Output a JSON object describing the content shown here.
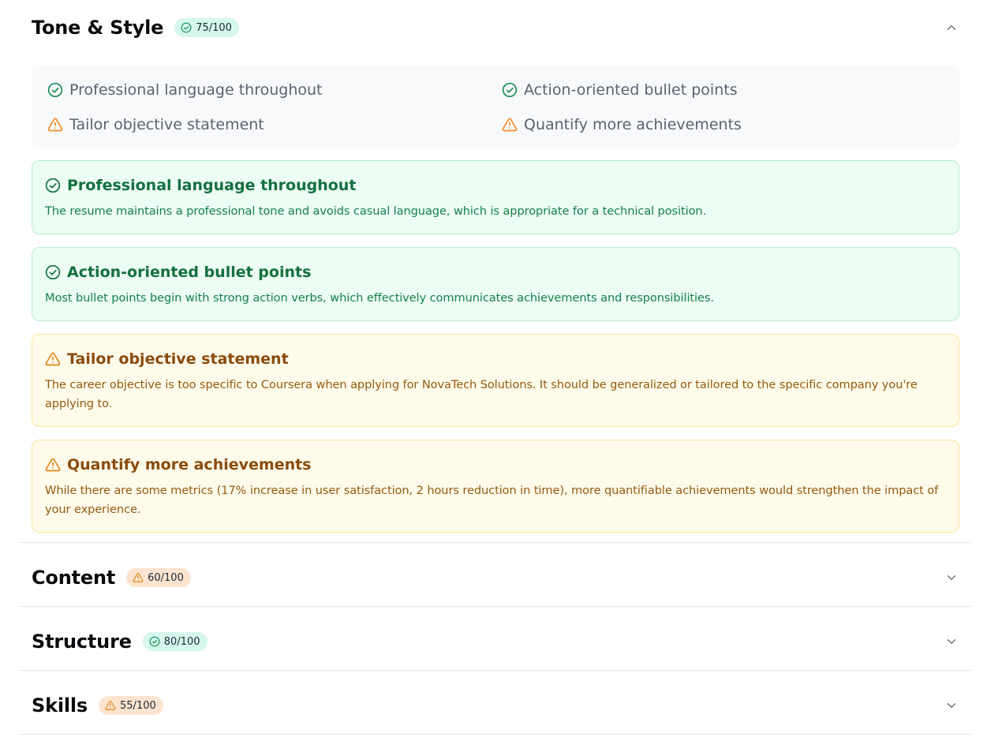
{
  "sections": [
    {
      "title": "Tone & Style",
      "score": "75/100",
      "status": "good",
      "expanded": true,
      "summary_items": [
        {
          "label": "Professional language throughout",
          "status": "good"
        },
        {
          "label": "Action-oriented bullet points",
          "status": "good"
        },
        {
          "label": "Tailor objective statement",
          "status": "warn"
        },
        {
          "label": "Quantify more achievements",
          "status": "warn"
        }
      ],
      "details": [
        {
          "title": "Professional language throughout",
          "status": "good",
          "body": "The resume maintains a professional tone and avoids casual language, which is appropriate for a technical position."
        },
        {
          "title": "Action-oriented bullet points",
          "status": "good",
          "body": "Most bullet points begin with strong action verbs, which effectively communicates achievements and responsibilities."
        },
        {
          "title": "Tailor objective statement",
          "status": "warn",
          "body": "The career objective is too specific to Coursera when applying for NovaTech Solutions. It should be generalized or tailored to the specific company you're applying to."
        },
        {
          "title": "Quantify more achievements",
          "status": "warn",
          "body": "While there are some metrics (17% increase in user satisfaction, 2 hours reduction in time), more quantifiable achievements would strengthen the impact of your experience."
        }
      ]
    },
    {
      "title": "Content",
      "score": "60/100",
      "status": "warn",
      "expanded": false
    },
    {
      "title": "Structure",
      "score": "80/100",
      "status": "good",
      "expanded": false
    },
    {
      "title": "Skills",
      "score": "55/100",
      "status": "warn",
      "expanded": false
    }
  ],
  "icons": {
    "good": "check-circle-icon",
    "warn": "warning-triangle-icon",
    "expanded": "chevron-up-icon",
    "collapsed": "chevron-down-icon"
  },
  "colors": {
    "good_badge_bg": "#d5f7ec",
    "warn_badge_bg": "#fde4cf",
    "good_icon": "#1a8f55",
    "warn_icon": "#f08a24",
    "good_card_bg": "#ecfdf3",
    "warn_card_bg": "#fffbea",
    "good_text": "#14703e",
    "warn_text": "#8a4b0c"
  }
}
